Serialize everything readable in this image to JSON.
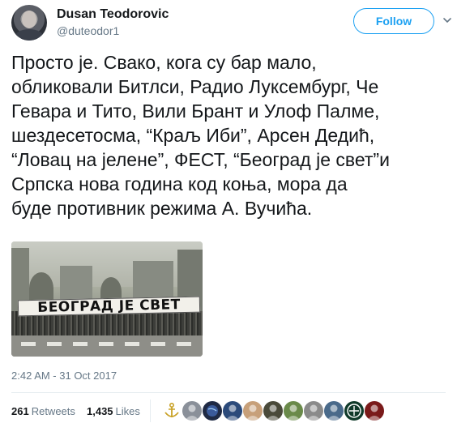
{
  "author": {
    "name": "Dusan Teodorovic",
    "handle": "@duteodor1"
  },
  "follow_button": {
    "label": "Follow"
  },
  "tweet": {
    "text": "Просто је. Свако, кога су бар мало,\nобликовали Битлси, Радио Луксембург, Че\nГевара и Тито, Вили Брант и Улоф Палме,\nшездесетосма, “Краљ Иби”, Арсен Дедић,\n“Ловац на јелене”, ФЕСТ, “Београд је свет”и\nСрпска нова година код коња, мора да\nбуде противник режима А. Вучића.",
    "photo_banner_text": "БЕОГРАД ЈЕ СВЕТ",
    "timestamp": "2:42 AM - 31 Oct 2017"
  },
  "stats": {
    "retweets_count": "261",
    "retweets_label": "Retweets",
    "likes_count": "1,435",
    "likes_label": "Likes"
  },
  "likers": [
    {
      "icon": "anchor-avatar",
      "color": "#ffffff"
    },
    {
      "icon": "user-avatar",
      "color": "#8a9099"
    },
    {
      "icon": "globe-avatar",
      "color": "#1f2a44"
    },
    {
      "icon": "user-avatar",
      "color": "#2b4a7a"
    },
    {
      "icon": "user-avatar",
      "color": "#c7a07a"
    },
    {
      "icon": "user-avatar",
      "color": "#4a4a3a"
    },
    {
      "icon": "user-avatar",
      "color": "#6a8a4a"
    },
    {
      "icon": "user-avatar",
      "color": "#8a8a8a"
    },
    {
      "icon": "user-avatar",
      "color": "#4a6a8a"
    },
    {
      "icon": "emblem-avatar",
      "color": "#103a2a"
    },
    {
      "icon": "user-avatar",
      "color": "#7a1a1a"
    }
  ]
}
